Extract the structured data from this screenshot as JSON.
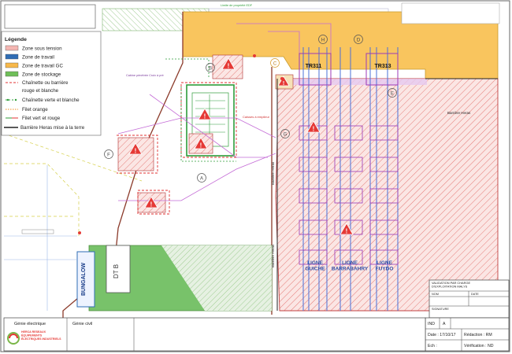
{
  "legend": {
    "title": "Légende",
    "items": [
      {
        "label": "Zone sous tension",
        "swatch": "#f4b6b2"
      },
      {
        "label": "Zone de travail",
        "swatch": "#2f6db5"
      },
      {
        "label": "Zone de travail GC",
        "swatch": "#f7b84a"
      },
      {
        "label": "Zone de stockage",
        "swatch": "#6fbf59"
      },
      {
        "label": "Chaînette ou barrière",
        "style": "red-dash"
      },
      {
        "label": "rouge et blanche",
        "style": "continuation"
      },
      {
        "label": "Chaînette verte et blanche",
        "style": "green-dash"
      },
      {
        "label": "Filet orange",
        "style": "orange-dash"
      },
      {
        "label": "Filet vert et rouge",
        "style": "greenred-dash"
      },
      {
        "label": "Barrière Heras mise à la terre",
        "style": "black-line"
      }
    ]
  },
  "plan": {
    "transformers": [
      "TR311",
      "TR313"
    ],
    "lines": [
      "LIGNE\nGUICHE",
      "LIGNE\nBARRABAHRY",
      "LIGNE\nFUYDO"
    ],
    "zone_letters": [
      "A",
      "B",
      "C",
      "D",
      "E",
      "F",
      "G",
      "H"
    ],
    "bungalow_labels": [
      "BUNGALOW",
      "DT B"
    ],
    "barrier_labels": [
      "Barrière Heras",
      "Barrière Heras",
      "Barrière Heras"
    ],
    "note_labels": [
      "Cabine pénétrée Croix à pré",
      "Caisses à empileur",
      "Limite de propriété EDF"
    ]
  },
  "title_block": {
    "validation": "VALIDATION PAR CHARGE\nD'EXPLOITATION MALYS",
    "nom": "NOM",
    "date": "DATE",
    "signature": "SIGNATURE",
    "ind_label": "IND",
    "ind_value": "A",
    "date_line": "Date : 17/10/17",
    "redaction": "Rédaction : RM",
    "ech": "Ech :",
    "verification": "Vérification : ND"
  },
  "footer": {
    "genie_electrique": "Génie électrique",
    "genie_civil": "Génie civil",
    "company_logo": "HERCA RESEAUX ÉQUIPEMENTS ÉLECTRIQUES INDUSTRIELS"
  },
  "colors": {
    "zone_sous_tension": "#f4b6b2",
    "zone_travail": "#2f6db5",
    "zone_travail_gc": "#f7b84a",
    "zone_stockage": "#6fbf59",
    "hatch_red": "#e05a5a",
    "plan_magenta": "#c46bd6",
    "plan_blue": "#4a70d8"
  }
}
